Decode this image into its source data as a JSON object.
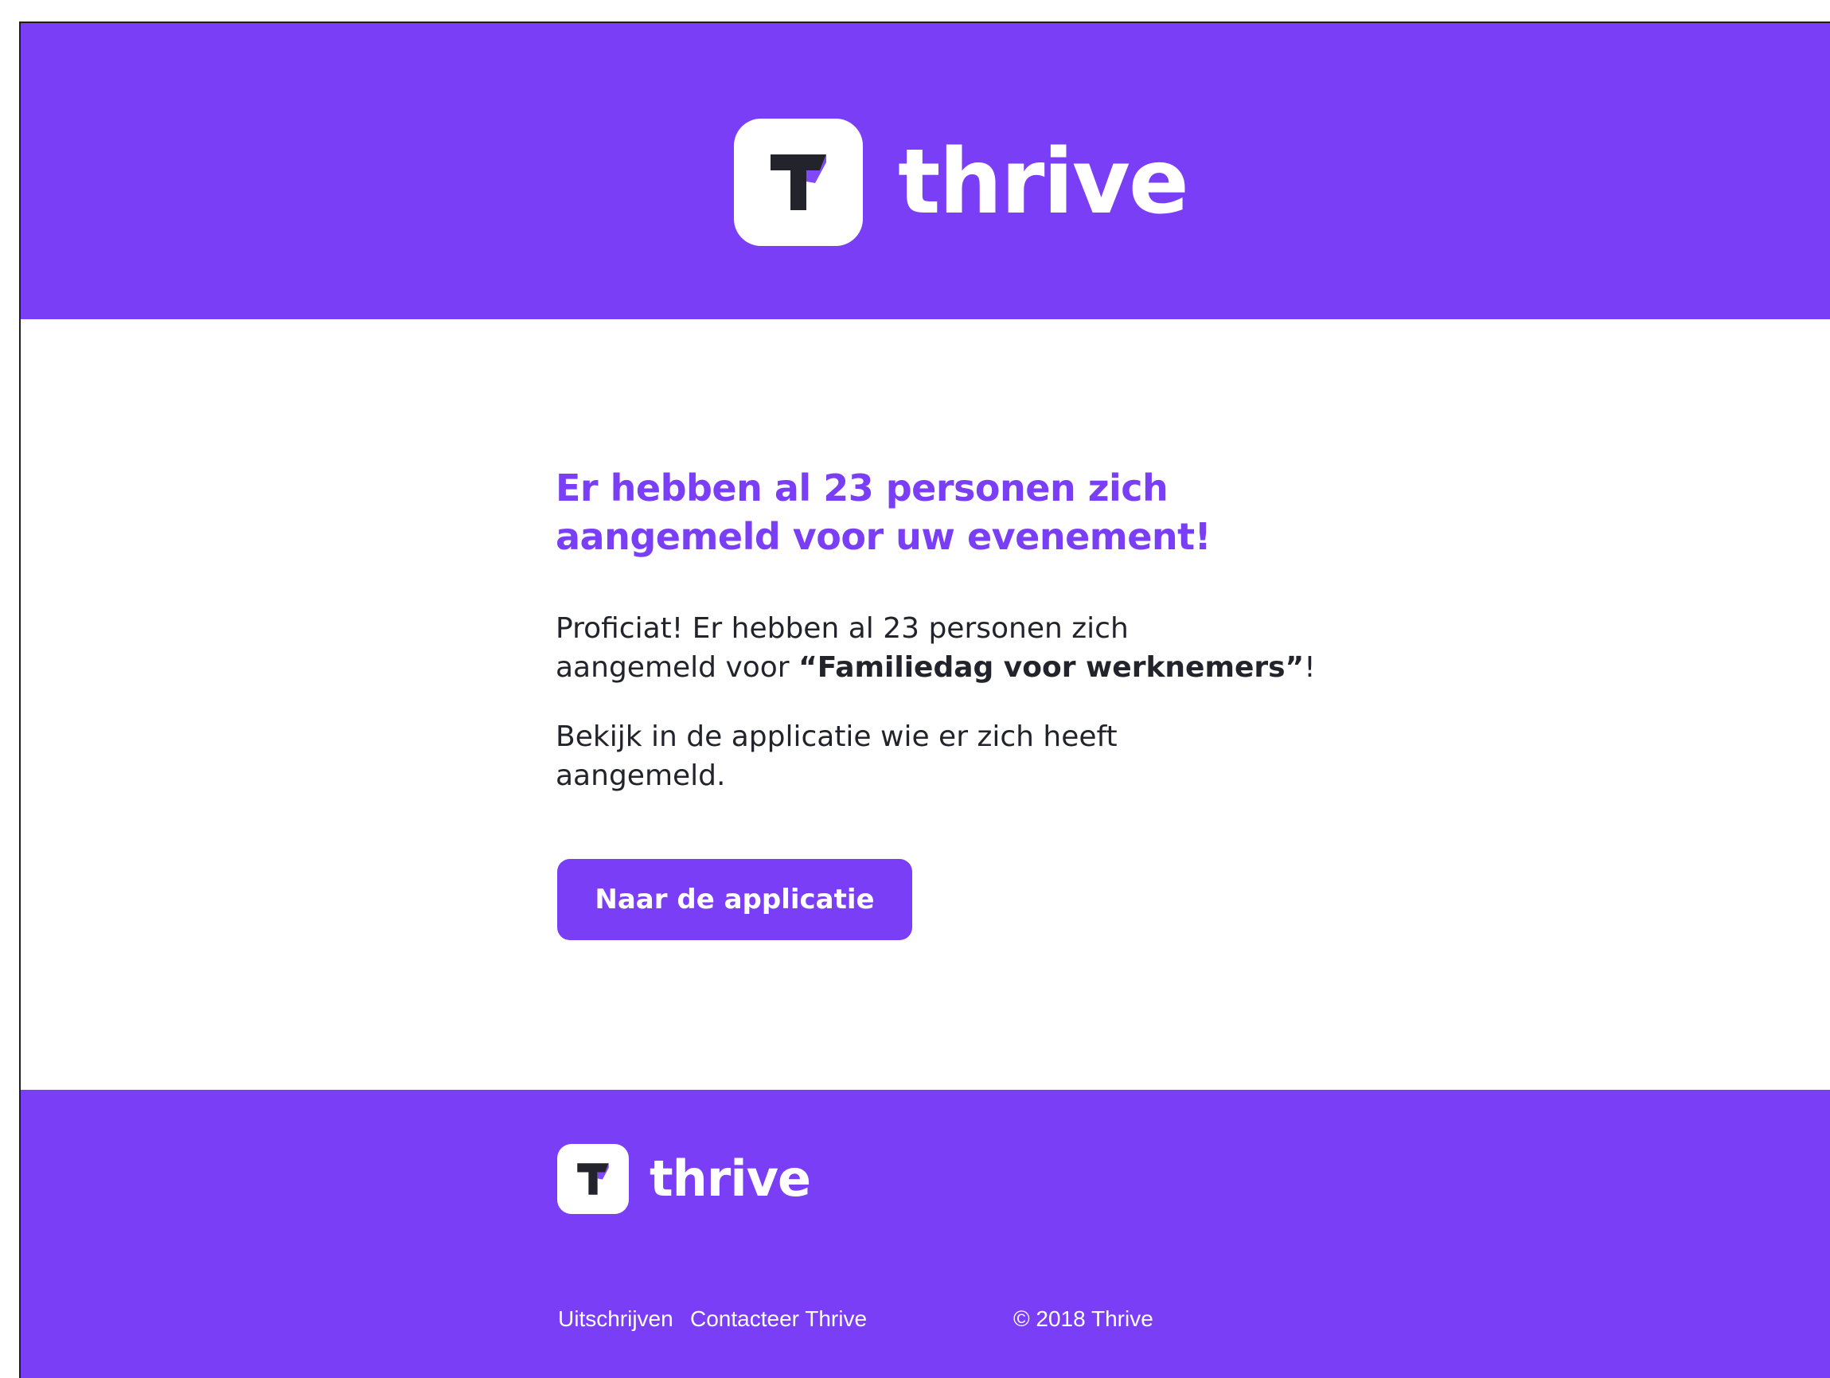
{
  "brand": {
    "name": "thrive",
    "colors": {
      "primary": "#7a3ef7",
      "text": "#23232b",
      "on_primary": "#ffffff",
      "logo_mark": "#23232b"
    },
    "logo_icon": "thrive-t-icon"
  },
  "header": {
    "logo_text": "thrive"
  },
  "main": {
    "headline_line1": "Er hebben al 23 personen zich",
    "headline_line2": "aangemeld voor uw evenement!",
    "paragraph1": {
      "line1": "Proficiat! Er hebben al 23 personen zich",
      "line2_prefix": "aangemeld voor ",
      "event_name": "“Familiedag voor werknemers”",
      "line2_suffix": "!"
    },
    "paragraph2": {
      "line1": "Bekijk in de applicatie wie er zich heeft",
      "line2": "aangemeld."
    },
    "cta_label": "Naar de applicatie"
  },
  "footer": {
    "logo_text": "thrive",
    "links": {
      "unsubscribe": "Uitschrijven",
      "contact": "Contacteer Thrive",
      "copyright": "© 2018 Thrive"
    }
  }
}
